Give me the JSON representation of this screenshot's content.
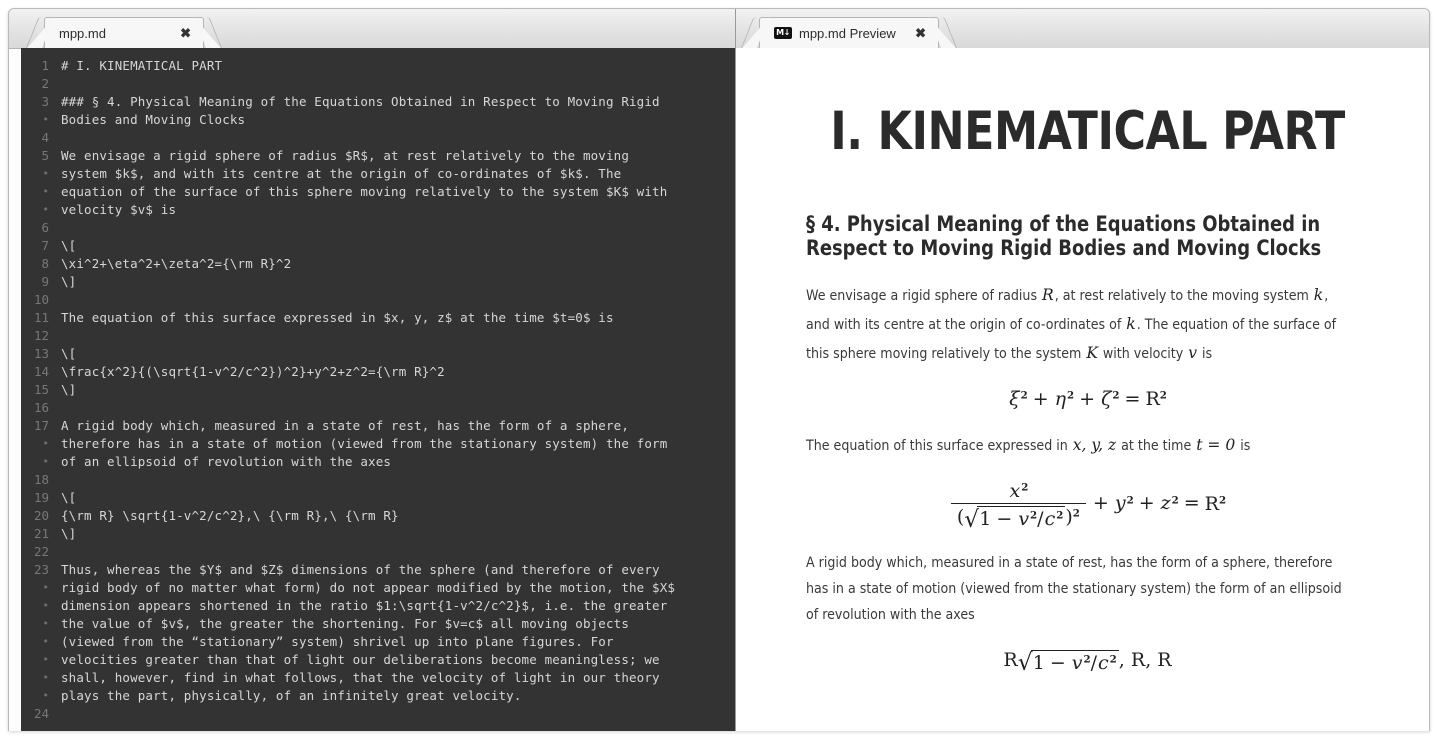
{
  "window": {
    "tabs": [
      {
        "id": "editor",
        "label": "mpp.md",
        "close": "✖",
        "icon": null
      },
      {
        "id": "preview",
        "label": "mpp.md Preview",
        "close": "✖",
        "icon": "markdown-icon",
        "icon_text": "M↓"
      }
    ]
  },
  "editor": {
    "language": "markdown",
    "background": "#333333",
    "text_color": "#d6d6d6",
    "gutter_color": "#777777",
    "lines": [
      {
        "num": "1",
        "text": "# I. KINEMATICAL PART"
      },
      {
        "num": "2",
        "text": ""
      },
      {
        "num": "3",
        "text": "### § 4. Physical Meaning of the Equations Obtained in Respect to Moving Rigid"
      },
      {
        "num": "•",
        "text": "Bodies and Moving Clocks"
      },
      {
        "num": "4",
        "text": ""
      },
      {
        "num": "5",
        "text": "We envisage a rigid sphere of radius $R$, at rest relatively to the moving"
      },
      {
        "num": "•",
        "text": "system $k$, and with its centre at the origin of co-ordinates of $k$. The"
      },
      {
        "num": "•",
        "text": "equation of the surface of this sphere moving relatively to the system $K$ with"
      },
      {
        "num": "•",
        "text": "velocity $v$ is"
      },
      {
        "num": "6",
        "text": ""
      },
      {
        "num": "7",
        "text": "\\["
      },
      {
        "num": "8",
        "text": "\\xi^2+\\eta^2+\\zeta^2={\\rm R}^2"
      },
      {
        "num": "9",
        "text": "\\]"
      },
      {
        "num": "10",
        "text": ""
      },
      {
        "num": "11",
        "text": "The equation of this surface expressed in $x, y, z$ at the time $t=0$ is"
      },
      {
        "num": "12",
        "text": ""
      },
      {
        "num": "13",
        "text": "\\["
      },
      {
        "num": "14",
        "text": "\\frac{x^2}{(\\sqrt{1-v^2/c^2})^2}+y^2+z^2={\\rm R}^2"
      },
      {
        "num": "15",
        "text": "\\]"
      },
      {
        "num": "16",
        "text": ""
      },
      {
        "num": "17",
        "text": "A rigid body which, measured in a state of rest, has the form of a sphere,"
      },
      {
        "num": "•",
        "text": "therefore has in a state of motion (viewed from the stationary system) the form"
      },
      {
        "num": "•",
        "text": "of an ellipsoid of revolution with the axes"
      },
      {
        "num": "18",
        "text": ""
      },
      {
        "num": "19",
        "text": "\\["
      },
      {
        "num": "20",
        "text": "{\\rm R} \\sqrt{1-v^2/c^2},\\ {\\rm R},\\ {\\rm R}"
      },
      {
        "num": "21",
        "text": "\\]"
      },
      {
        "num": "22",
        "text": ""
      },
      {
        "num": "23",
        "text": "Thus, whereas the $Y$ and $Z$ dimensions of the sphere (and therefore of every"
      },
      {
        "num": "•",
        "text": "rigid body of no matter what form) do not appear modified by the motion, the $X$"
      },
      {
        "num": "•",
        "text": "dimension appears shortened in the ratio $1:\\sqrt{1-v^2/c^2}$, i.e. the greater"
      },
      {
        "num": "•",
        "text": "the value of $v$, the greater the shortening. For $v=c$ all moving objects"
      },
      {
        "num": "•",
        "text": "(viewed from the “stationary” system) shrivel up into plane figures. For"
      },
      {
        "num": "•",
        "text": "velocities greater than that of light our deliberations become meaningless; we"
      },
      {
        "num": "•",
        "text": "shall, however, find in what follows, that the velocity of light in our theory"
      },
      {
        "num": "•",
        "text": "plays the part, physically, of an infinitely great velocity."
      },
      {
        "num": "24",
        "text": ""
      }
    ]
  },
  "preview": {
    "title": "I. KINEMATICAL PART",
    "subtitle": "§ 4. Physical Meaning of the Equations Obtained in Respect to Moving Rigid Bodies and Moving Clocks",
    "paragraph1": {
      "t1": "We envisage a rigid sphere of radius ",
      "m1": "R",
      "t2": ", at rest relatively to the moving system ",
      "m2": "k",
      "t3": ", and with its centre at the origin of co-ordinates of ",
      "m3": "k",
      "t4": ". The equation of the surface of this sphere moving relatively to the system ",
      "m4": "K",
      "t5": " with velocity ",
      "m5": "v",
      "t6": " is"
    },
    "equation1": {
      "xi": "ξ",
      "eta": "η",
      "zeta": "ζ",
      "plus": "+",
      "equals": "=",
      "R": "R",
      "exp": "2"
    },
    "paragraph2": {
      "t1": "The equation of this surface expressed in ",
      "m1": "x, y, z",
      "t2": " at the time ",
      "m2": "t = 0",
      "t3": " is"
    },
    "equation2": {
      "x": "x",
      "v": "v",
      "c": "c",
      "y": "y",
      "z": "z",
      "R": "R",
      "one": "1",
      "minus": "−",
      "slash": "/",
      "radical": "√",
      "plus": "+",
      "equals": "=",
      "exp": "2",
      "lparen": "(",
      "rparen": ")"
    },
    "paragraph3": "A rigid body which, measured in a state of rest, has the form of a sphere, therefore has in a state of motion (viewed from the stationary system) the form of an ellipsoid of revolution with the axes",
    "equation3": {
      "R": "R",
      "one": "1",
      "minus": "−",
      "v": "v",
      "c": "c",
      "slash": "/",
      "radical": "√",
      "exp": "2",
      "comma": ", "
    }
  },
  "colors": {
    "editor_bg": "#333333",
    "editor_text": "#d6d6d6",
    "gutter": "#777777",
    "preview_bg": "#ffffff",
    "preview_text": "#3a3a3a",
    "heading": "#2b2b2b",
    "chrome": "#e3e3e3"
  }
}
